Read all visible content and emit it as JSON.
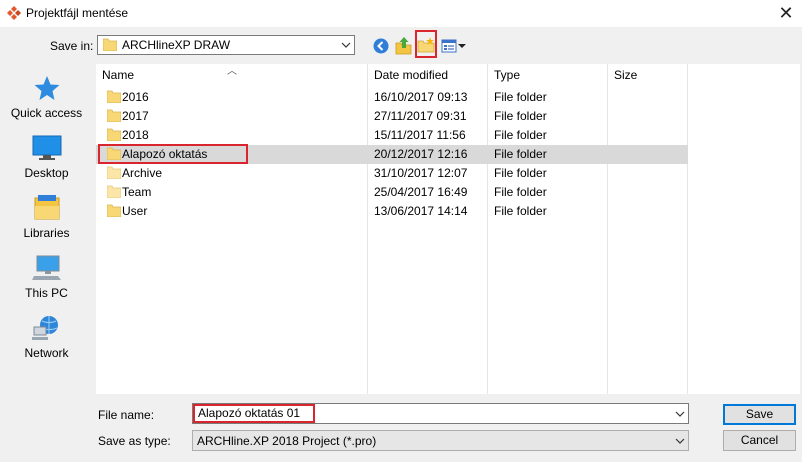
{
  "window": {
    "title": "Projektfájl mentése",
    "close_glyph": "✕"
  },
  "toolbar": {
    "save_in_label": "Save in:",
    "save_in_value": "ARCHlineXP DRAW",
    "icons": [
      "back-icon",
      "up-folder-icon",
      "new-folder-icon",
      "views-menu-icon"
    ]
  },
  "places": [
    {
      "label": "Quick access",
      "icon": "star-icon"
    },
    {
      "label": "Desktop",
      "icon": "desktop-icon"
    },
    {
      "label": "Libraries",
      "icon": "libraries-icon"
    },
    {
      "label": "This PC",
      "icon": "computer-icon"
    },
    {
      "label": "Network",
      "icon": "network-icon"
    }
  ],
  "columns": {
    "name": "Name",
    "date": "Date modified",
    "type": "Type",
    "size": "Size"
  },
  "files": [
    {
      "name": "2016",
      "date": "16/10/2017 09:13",
      "type": "File folder"
    },
    {
      "name": "2017",
      "date": "27/11/2017 09:31",
      "type": "File folder"
    },
    {
      "name": "2018",
      "date": "15/11/2017 11:56",
      "type": "File folder"
    },
    {
      "name": "Alapozó oktatás",
      "date": "20/12/2017 12:16",
      "type": "File folder",
      "selected": true
    },
    {
      "name": "Archive",
      "date": "31/10/2017 12:07",
      "type": "File folder"
    },
    {
      "name": "Team",
      "date": "25/04/2017 16:49",
      "type": "File folder"
    },
    {
      "name": "User",
      "date": "13/06/2017 14:14",
      "type": "File folder"
    }
  ],
  "form": {
    "file_name_label": "File name:",
    "file_name_value": "Alapozó oktatás 01",
    "save_as_type_label": "Save as type:",
    "save_as_type_value": "ARCHline.XP 2018 Project (*.pro)",
    "save_label": "Save",
    "cancel_label": "Cancel"
  },
  "colors": {
    "highlight": "#d9262e",
    "accent": "#0078d7",
    "folder": "#f8d775",
    "selected_row": "#d9d9d9"
  }
}
